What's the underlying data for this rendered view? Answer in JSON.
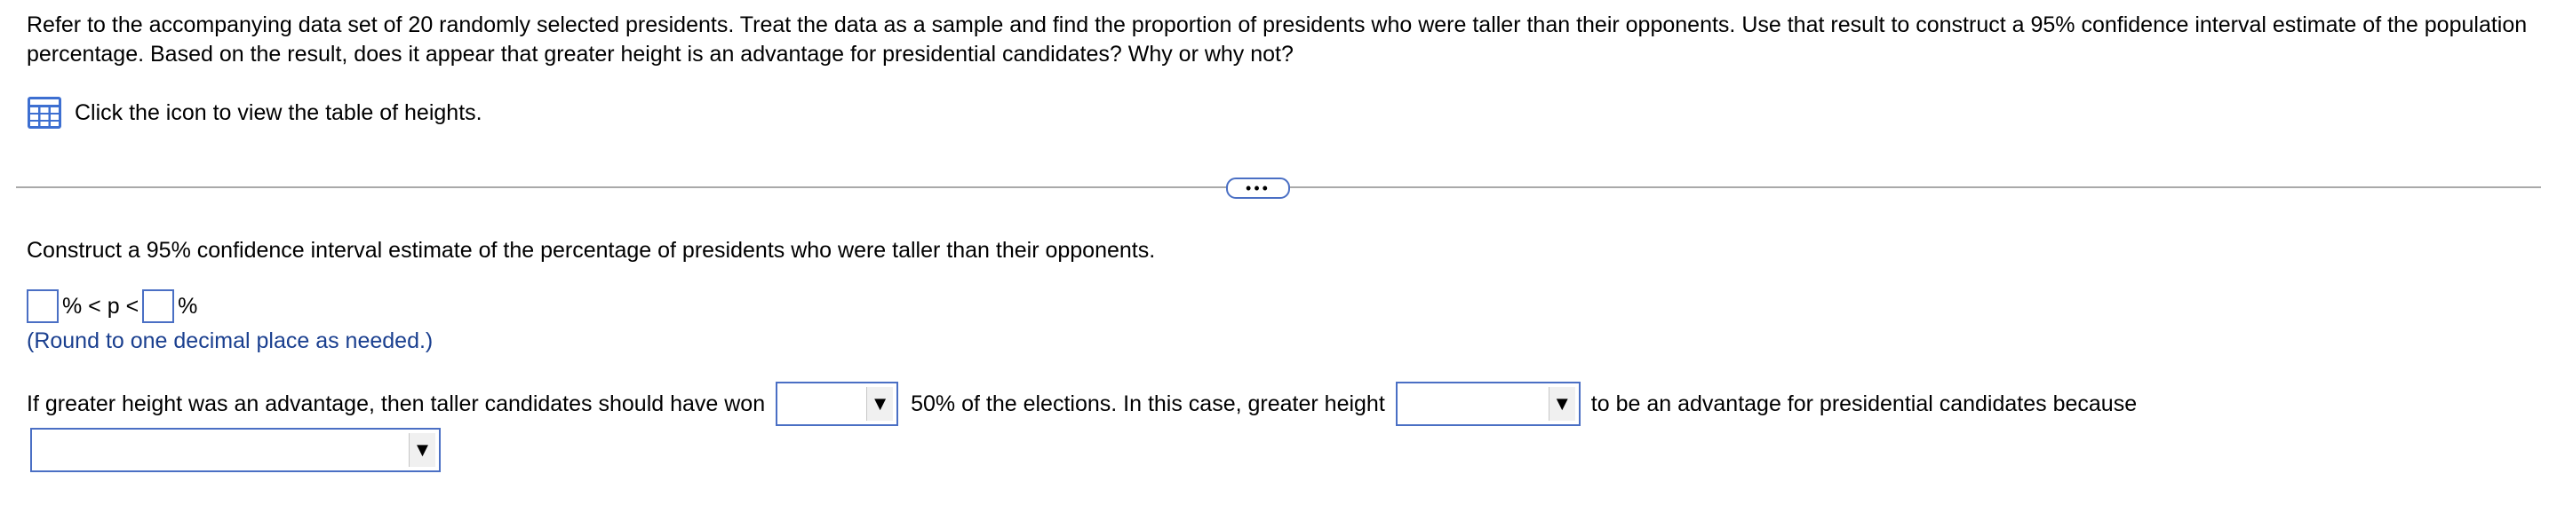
{
  "question": {
    "text": "Refer to the accompanying data set of 20 randomly selected presidents. Treat the data as a sample and find the proportion of presidents who were taller than their opponents. Use that result to construct a 95% confidence interval estimate of the population percentage. Based on the result, does it appear that greater height is an advantage for presidential candidates? Why or why not?"
  },
  "table_link": {
    "label": "Click the icon to view the table of heights.",
    "icon": "table-grid-icon",
    "icon_color": "#3d6fd1"
  },
  "more_button": {
    "label": "•••"
  },
  "part_a": {
    "prompt": "Construct a 95% confidence interval estimate of the percentage of presidents who were taller than their opponents.",
    "interval": {
      "lower_value": "",
      "upper_value": "",
      "between_text": "% < p <",
      "end_text": "%"
    },
    "hint": "(Round to one decimal place as needed.)"
  },
  "part_b": {
    "text_1": "If greater height was an advantage, then taller candidates should have won",
    "dropdown_1_value": "",
    "text_2": "50% of the elections. In this case, greater height",
    "dropdown_2_value": "",
    "text_3": "to be an advantage for presidential candidates because",
    "dropdown_3_value": ""
  },
  "colors": {
    "accent_border": "#4a6fc4",
    "hint_text": "#1a3f8f",
    "divider": "#a9a9a9"
  }
}
